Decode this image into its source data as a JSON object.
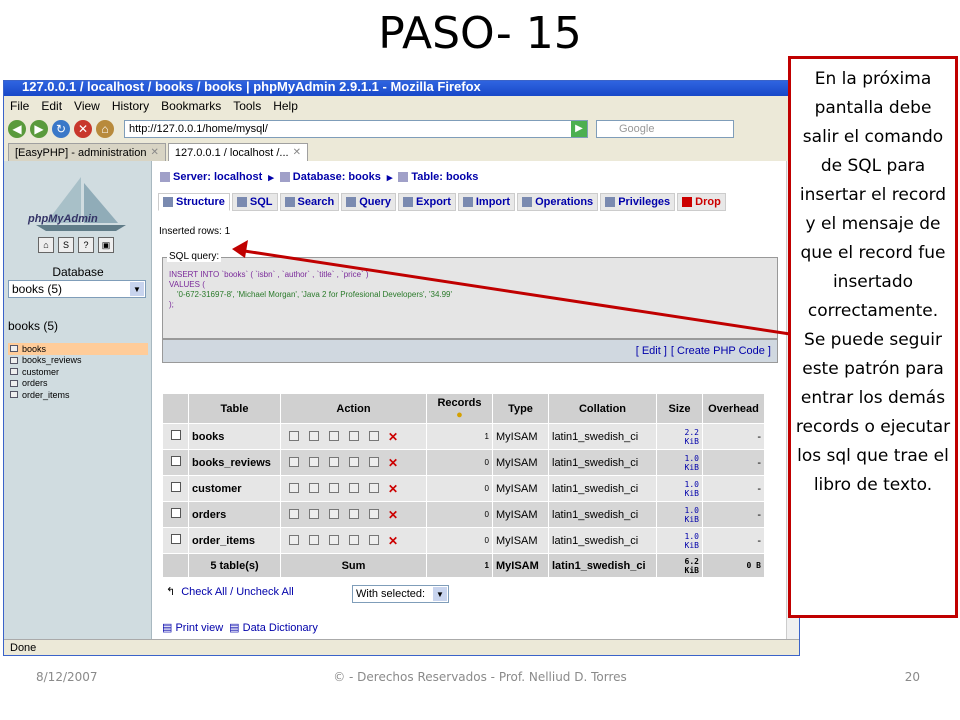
{
  "slide": {
    "title": "PASO- 15",
    "callout": "En la próxima pantalla debe salir el comando de SQL para insertar el record y el mensaje de que el record fue insertado correctamente. Se puede seguir este patrón para entrar los demás records o ejecutar los sql que trae el libro de texto.",
    "footer_date": "8/12/2007",
    "footer_copyright": "© - Derechos Reservados  - Prof. Nelliud D. Torres",
    "footer_page": "20",
    "arrow_color": "#c00000"
  },
  "browser": {
    "title": "127.0.0.1 / localhost / books / books | phpMyAdmin 2.9.1.1 - Mozilla Firefox",
    "menu": [
      "File",
      "Edit",
      "View",
      "History",
      "Bookmarks",
      "Tools",
      "Help"
    ],
    "url": "http://127.0.0.1/home/mysql/",
    "search_placeholder": "Google",
    "tabs": [
      "[EasyPHP] - administration",
      "127.0.0.1 / localhost /..."
    ],
    "status": "Done"
  },
  "sidebar": {
    "logo": "phpMyAdmin",
    "db_label": "Database",
    "db_select": "books (5)",
    "db_name": "books (5)",
    "tables": [
      "books",
      "books_reviews",
      "customer",
      "orders",
      "order_items"
    ]
  },
  "main": {
    "crumbs": [
      "Server: localhost",
      "Database: books",
      "Table: books"
    ],
    "tabs": [
      "Structure",
      "SQL",
      "Search",
      "Query",
      "Export",
      "Import",
      "Operations",
      "Privileges",
      "Drop"
    ],
    "inserted": "Inserted rows: 1",
    "sql_legend": "SQL query:",
    "sql_line1": "INSERT INTO `books` ( `isbn` , `author` , `title` , `price` )",
    "sql_line2": "VALUES (",
    "sql_line3": "'0-672-31697-8', 'Michael Morgan', 'Java 2 for Profesional Developers', '34.99'",
    "sql_line4": ");",
    "edit_link": "[ Edit ]",
    "create_php_link": "[ Create PHP Code ]",
    "headers": [
      "Table",
      "Action",
      "Records",
      "Type",
      "Collation",
      "Size",
      "Overhead"
    ],
    "rows": [
      {
        "name": "books",
        "records": "1",
        "type": "MyISAM",
        "collation": "latin1_swedish_ci",
        "size1": "2.2",
        "size2": "KiB",
        "overhead": "-"
      },
      {
        "name": "books_reviews",
        "records": "0",
        "type": "MyISAM",
        "collation": "latin1_swedish_ci",
        "size1": "1.0",
        "size2": "KiB",
        "overhead": "-"
      },
      {
        "name": "customer",
        "records": "0",
        "type": "MyISAM",
        "collation": "latin1_swedish_ci",
        "size1": "1.0",
        "size2": "KiB",
        "overhead": "-"
      },
      {
        "name": "orders",
        "records": "0",
        "type": "MyISAM",
        "collation": "latin1_swedish_ci",
        "size1": "1.0",
        "size2": "KiB",
        "overhead": "-"
      },
      {
        "name": "order_items",
        "records": "0",
        "type": "MyISAM",
        "collation": "latin1_swedish_ci",
        "size1": "1.0",
        "size2": "KiB",
        "overhead": "-"
      }
    ],
    "sum": {
      "tables": "5 table(s)",
      "label": "Sum",
      "records": "1",
      "type": "MyISAM",
      "collation": "latin1_swedish_ci",
      "size1": "6.2",
      "size2": "KiB",
      "overhead": "0 B"
    },
    "check_all": "Check All / Uncheck All",
    "with_selected": "With selected:",
    "print_view": "Print view",
    "data_dictionary": "Data Dictionary"
  }
}
